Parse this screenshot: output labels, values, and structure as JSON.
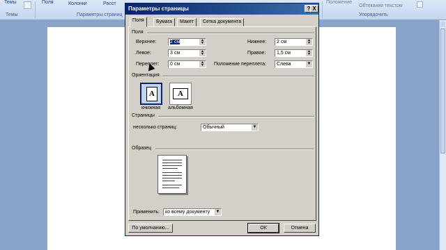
{
  "ribbon": {
    "items": {
      "themes": "Темы",
      "fields": "Поля",
      "columns": "Колонки",
      "spacing": "Расст",
      "position": "Положение",
      "wrap": "Обтекание текстом"
    },
    "groups": {
      "themes": "Темы",
      "page_setup": "Параметры страниц",
      "arrange": "Упорядочить"
    }
  },
  "dialog": {
    "title": "Параметры страницы",
    "help": "?",
    "close": "X",
    "tabs": [
      "Поля",
      "Бумага",
      "Макет",
      "Сетка документа"
    ],
    "margins_section": "Поля",
    "fields": {
      "top_label": "Верхнее:",
      "top_value": "2 см",
      "bottom_label": "Нижнее:",
      "bottom_value": "2 см",
      "left_label": "Левое:",
      "left_value": "3 см",
      "right_label": "Правое:",
      "right_value": "1,5 см",
      "gutter_label": "Переплет:",
      "gutter_value": "0 см",
      "gutter_pos_label": "Положение переплета:",
      "gutter_pos_value": "Слева"
    },
    "orientation_section": "Ориентация",
    "orientation": {
      "portrait": "книжная",
      "landscape": "альбомная",
      "icon_letter": "A"
    },
    "pages_section": "Страницы",
    "pages": {
      "multiple_label": "несколько страниц:",
      "multiple_value": "Обычный"
    },
    "preview_section": "Образец",
    "apply": {
      "label": "Применить:",
      "value": "ко всему документу"
    },
    "buttons": {
      "default": "По умолчанию...",
      "ok": "ОК",
      "cancel": "Отмена"
    }
  }
}
